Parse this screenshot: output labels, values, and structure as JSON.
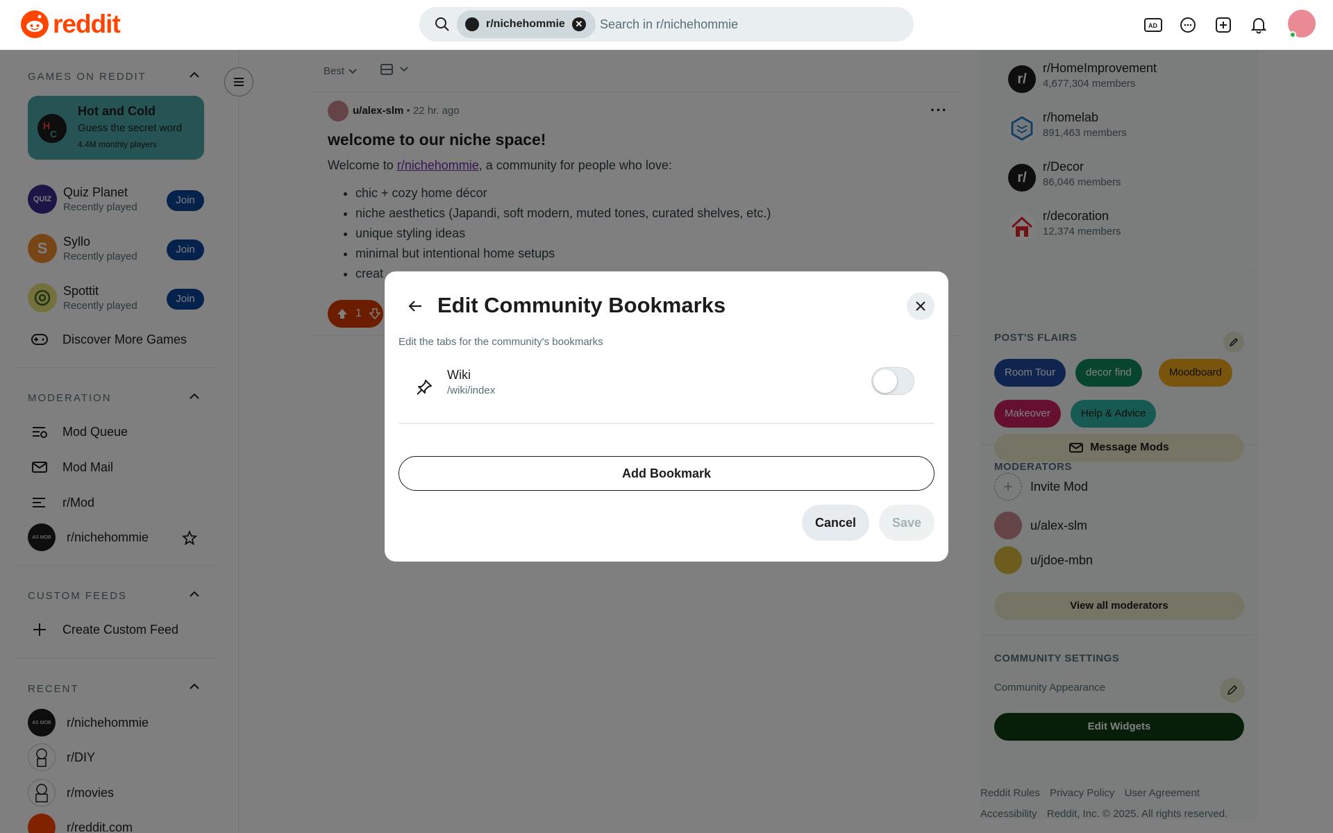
{
  "header": {
    "logo_text": "reddit",
    "search_chip": "r/nichehommie",
    "search_placeholder": "Search in r/nichehommie",
    "icons": [
      "advertise-icon",
      "chat-icon",
      "create-post-icon",
      "notifications-icon",
      "user-avatar"
    ]
  },
  "left_sidebar": {
    "games_header": "GAMES ON REDDIT",
    "featured_game": {
      "title": "Hot and Cold",
      "subtitle": "Guess the secret word",
      "players": "4.4M monthly players"
    },
    "games": [
      {
        "name": "Quiz Planet",
        "status": "Recently played",
        "join": "Join"
      },
      {
        "name": "Syllo",
        "status": "Recently played",
        "join": "Join"
      },
      {
        "name": "Spottit",
        "status": "Recently played",
        "join": "Join"
      }
    ],
    "discover": "Discover More Games",
    "moderation_header": "MODERATION",
    "moderation_items": [
      "Mod Queue",
      "Mod Mail",
      "r/Mod",
      "r/nichehommie"
    ],
    "custom_feeds_header": "CUSTOM FEEDS",
    "create_custom_feed": "Create Custom Feed",
    "recent_header": "RECENT",
    "recent_items": [
      "r/nichehommie",
      "r/DIY",
      "r/movies",
      "r/reddit.com"
    ]
  },
  "main": {
    "sort_label": "Best",
    "post": {
      "author": "u/alex-slm",
      "time": "22 hr. ago",
      "title": "welcome to our niche space!",
      "body_prefix": "Welcome to ",
      "body_link": "r/nichehommie",
      "body_suffix": ", a community for people who love:",
      "bullets": [
        "chic + cozy home décor",
        "niche aesthetics (Japandi, soft modern, muted tones, curated shelves, etc.)",
        "unique styling ideas",
        "minimal but intentional home setups",
        "creat"
      ],
      "votes": "1"
    }
  },
  "right_sidebar": {
    "communities": [
      {
        "name": "r/HomeImprovement",
        "members": "4,677,304 members"
      },
      {
        "name": "r/homelab",
        "members": "891,463 members"
      },
      {
        "name": "r/Decor",
        "members": "86,046 members"
      },
      {
        "name": "r/decoration",
        "members": "12,374 members"
      }
    ],
    "flairs_header": "POST'S FLAIRS",
    "flairs": [
      "Room Tour",
      "decor find",
      "Moodboard",
      "Makeover",
      "Help & Advice"
    ],
    "moderators_header": "MODERATORS",
    "message_mods": "Message Mods",
    "invite_mod": "Invite Mod",
    "moderators": [
      "u/alex-slm",
      "u/jdoe-mbn"
    ],
    "view_all": "View all moderators",
    "settings_header": "COMMUNITY SETTINGS",
    "community_appearance": "Community Appearance",
    "edit_widgets": "Edit Widgets",
    "footer": {
      "rules": "Reddit Rules",
      "privacy": "Privacy Policy",
      "agreement": "User Agreement",
      "accessibility": "Accessibility",
      "copyright": "Reddit, Inc. © 2025. All rights reserved."
    }
  },
  "modal": {
    "title": "Edit Community Bookmarks",
    "subtitle": "Edit the tabs for the community's bookmarks",
    "bookmark": {
      "name": "Wiki",
      "path": "/wiki/index",
      "enabled": false
    },
    "add_bookmark": "Add Bookmark",
    "cancel": "Cancel",
    "save": "Save"
  },
  "colors": {
    "brand": "#ff4500",
    "join": "#0a449b",
    "edit_widgets": "#0e3f13",
    "vote": "#d93a00"
  }
}
